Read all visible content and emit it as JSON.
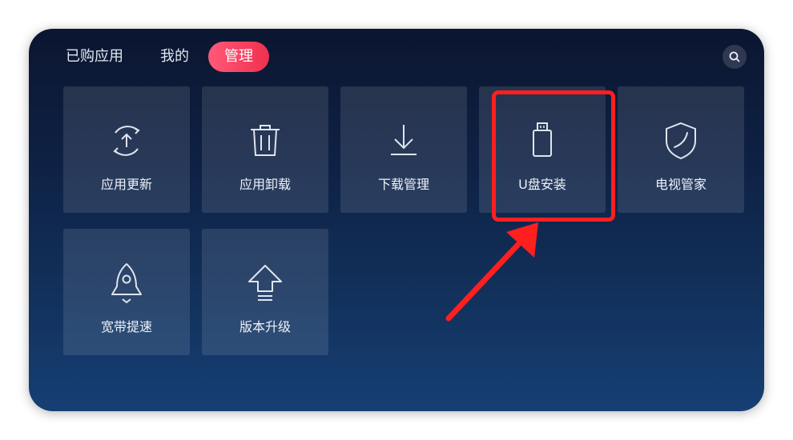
{
  "tabs": [
    {
      "label": "已购应用",
      "active": false
    },
    {
      "label": "我的",
      "active": false
    },
    {
      "label": "管理",
      "active": true
    }
  ],
  "search_icon": "search-icon",
  "tiles": [
    {
      "label": "应用更新",
      "icon": "refresh-upload-icon"
    },
    {
      "label": "应用卸载",
      "icon": "trash-icon"
    },
    {
      "label": "下载管理",
      "icon": "download-icon"
    },
    {
      "label": "U盘安装",
      "icon": "usb-drive-icon"
    },
    {
      "label": "电视管家",
      "icon": "shield-icon"
    },
    {
      "label": "宽带提速",
      "icon": "rocket-icon"
    },
    {
      "label": "版本升级",
      "icon": "upgrade-arrow-icon"
    }
  ],
  "annotation": {
    "highlight_target": "U盘安装",
    "highlight_color": "#ff1f1f"
  },
  "colors": {
    "active_tab": "#f0304e",
    "background_top": "#0b1630",
    "background_bottom": "#163f74"
  }
}
